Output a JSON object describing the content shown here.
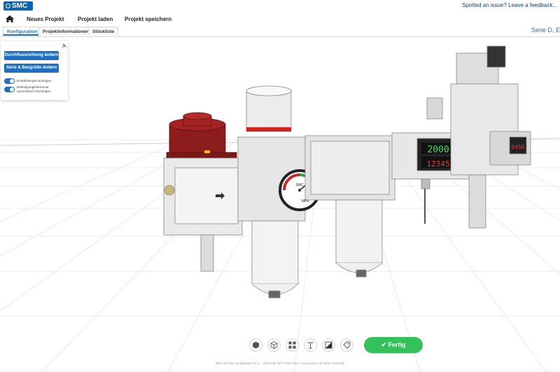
{
  "app": {
    "logo_text": "SMC"
  },
  "feedback": {
    "text": "Spotted an issue? Leave a feedback..."
  },
  "menu": {
    "items": [
      "Neues Projekt",
      "Projekt laden",
      "Projekt speichern"
    ]
  },
  "tabs": [
    "Konfiguration",
    "Projektinformationen",
    "Stückliste"
  ],
  "series_label": "Serie D, E",
  "panel": {
    "button1": "Durchflussrichtung ändern",
    "button2": "Serie & Baugröße ändern",
    "toggle1": "Empfehlungen anzeigen",
    "toggle2": "Befestigungselemente automatisch hinzufügen"
  },
  "gauge": {
    "brand": "SMC",
    "text": "MPa"
  },
  "display": {
    "top": "2000",
    "bottom": "12345",
    "side": "0456"
  },
  "toolbar": {
    "icons": [
      "cube-solid-icon",
      "cube-wireframe-icon",
      "explode-icon",
      "dimension-icon",
      "contrast-icon",
      "tag-icon"
    ],
    "done_label": "Fertig"
  },
  "footer": {
    "text": "SMC 3D FRL Configurator V1.1 – 2022 Mar 08 © 2022 SMC Corporation. All rights reserved."
  },
  "colors": {
    "accent": "#1f6fc0",
    "success": "#34c05a",
    "logo": "#0d63b3"
  }
}
